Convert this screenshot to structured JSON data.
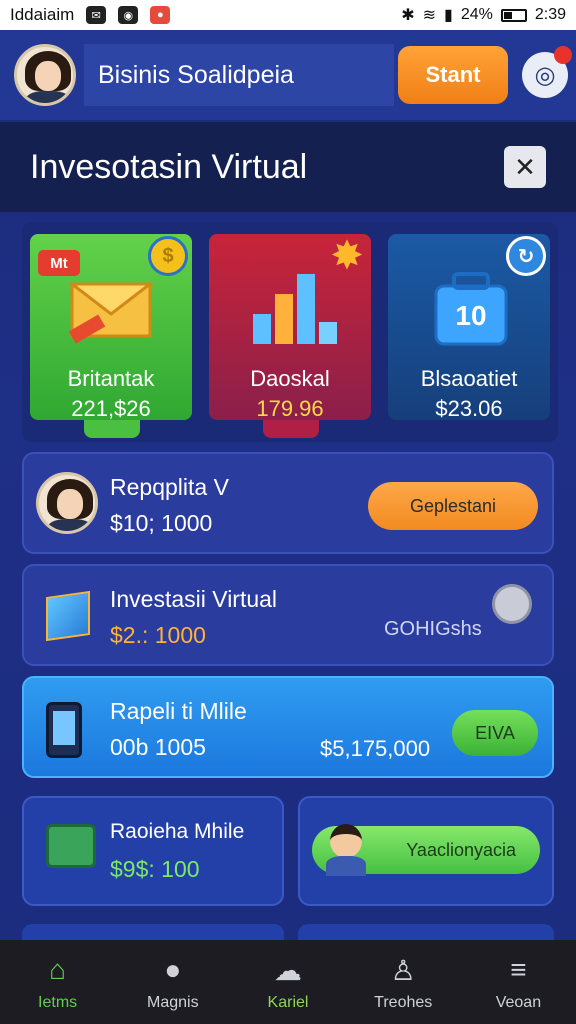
{
  "status_bar": {
    "carrier": "Iddaiaim",
    "battery_pct": "24%",
    "time": "2:39"
  },
  "header": {
    "username": "Bisinis Soalidpeia",
    "start_label": "Stant"
  },
  "title_bar": {
    "title": "Invesotasin Virtual"
  },
  "cards": [
    {
      "name": "Britantak",
      "value": "221,$26",
      "tag": "Mt"
    },
    {
      "name": "Daoskal",
      "value": "179.96"
    },
    {
      "name": "Blsaoatiet",
      "value": "$23.06",
      "icon_label": "10"
    }
  ],
  "list_items": [
    {
      "title": "Repqplita V",
      "amount": "$10; 1000",
      "button": "Geplestani"
    },
    {
      "title": "Investasii Virtual",
      "amount": "$2.: 1000",
      "right_text": "GOHIGshs"
    },
    {
      "title": "Rapeli ti Mlile",
      "amount": "00b 1005",
      "right_amount": "$5,175,000",
      "button": "EIVA"
    }
  ],
  "half_cards": {
    "left": {
      "title": "Raoieha Mhile",
      "amount": "$9$: 100"
    },
    "right": {
      "button": "Yaaclionyacia"
    }
  },
  "bottom_nav": [
    {
      "label": "Ietms",
      "icon": "home-icon"
    },
    {
      "label": "Magnis",
      "icon": "pin-icon"
    },
    {
      "label": "Kariel",
      "icon": "cloud-icon"
    },
    {
      "label": "Treohes",
      "icon": "user-icon"
    },
    {
      "label": "Veoan",
      "icon": "stack-icon"
    }
  ],
  "colors": {
    "accent_orange": "#f28a1f",
    "accent_green": "#46c042",
    "background": "#1e2f86"
  }
}
